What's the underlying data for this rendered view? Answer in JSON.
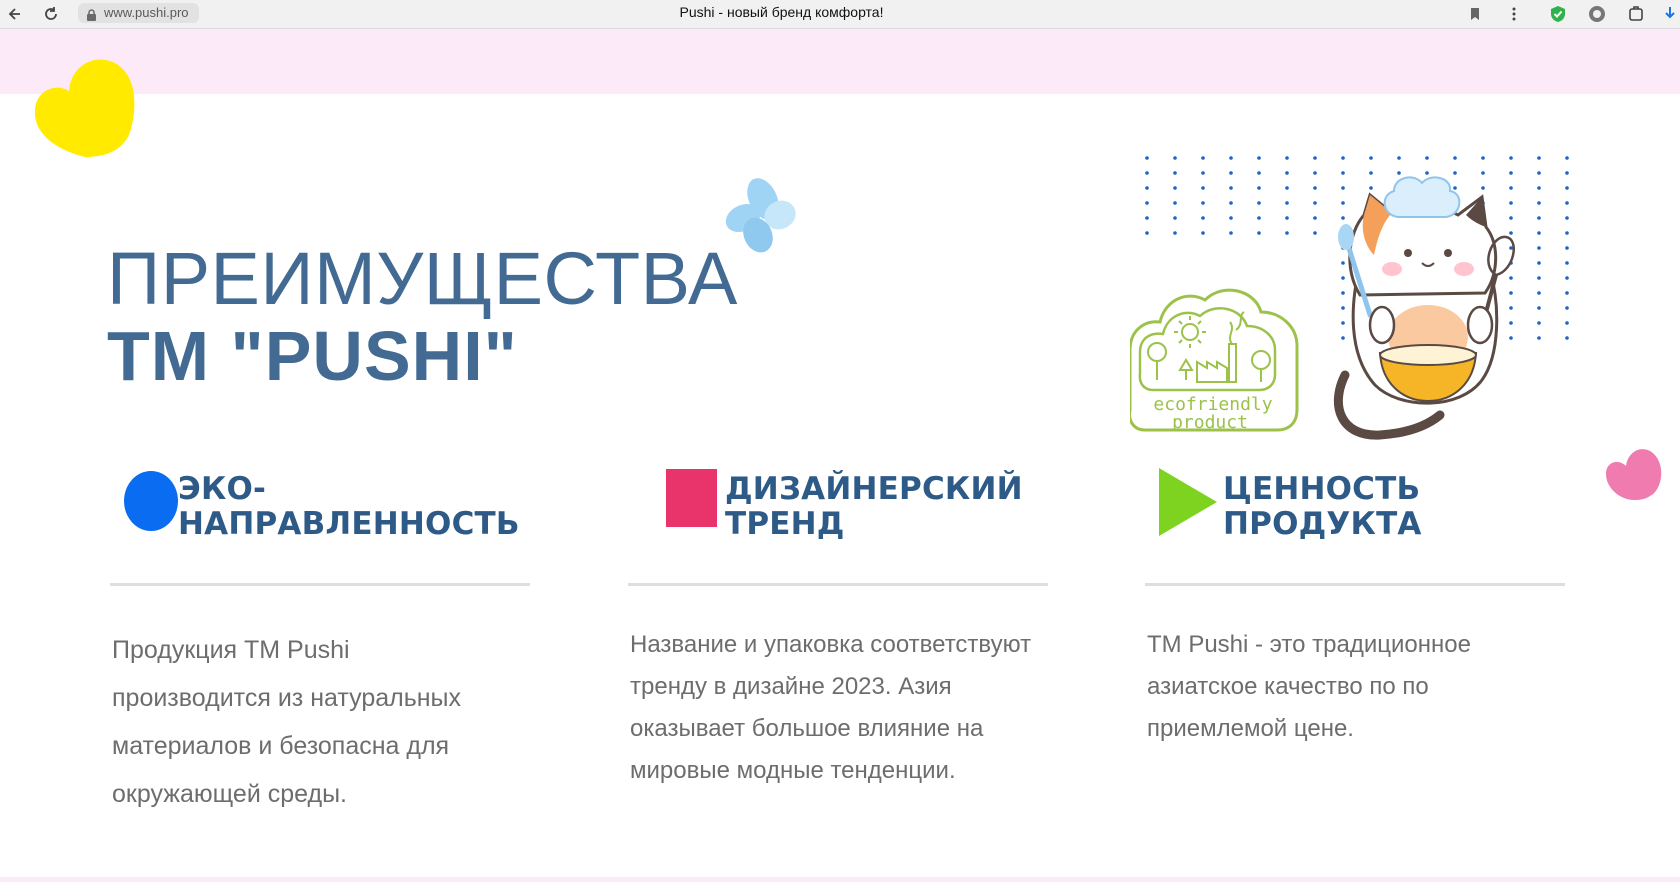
{
  "browser": {
    "url": "www.pushi.pro",
    "tab_title": "Pushi - новый бренд комфорта!"
  },
  "page": {
    "heading_line1": "ПРЕИМУЩЕСТВА",
    "heading_line2": "ТМ \"PUSHI\"",
    "badge": {
      "line1": "ecofriendly",
      "line2": "product"
    },
    "features": [
      {
        "title_line1": "ЭКО-",
        "title_line2": "НАПРАВЛЕННОСТЬ",
        "text_lines": [
          "Продукция ТМ Pushi",
          "производится из натуральных",
          "материалов и безопасна для",
          "окружающей среды."
        ],
        "marker": "blue-circle"
      },
      {
        "title_line1": "ДИЗАЙНЕРСКИЙ",
        "title_line2": "ТРЕНД",
        "text_lines": [
          "Название и упаковка соответствуют",
          "тренду в дизайне 2023. Азия",
          "оказывает большое влияние на",
          "мировые модные тенденции."
        ],
        "marker": "pink-square"
      },
      {
        "title_line1": "ЦЕННОСТЬ",
        "title_line2": "ПРОДУКТА",
        "text_lines": [
          "ТМ Pushi - это традиционное",
          "азиатское качество по по",
          "приемлемой цене."
        ],
        "marker": "green-triangle"
      }
    ]
  },
  "colors": {
    "heading": "#426a92",
    "feature_title": "#2d5a86",
    "body_text": "#6d6d6d",
    "pink_band": "#fdeaf8",
    "marker_blue": "#0a6cf0",
    "marker_pink": "#e8346a",
    "marker_green": "#7ed321",
    "badge_green": "#9cc24a"
  }
}
